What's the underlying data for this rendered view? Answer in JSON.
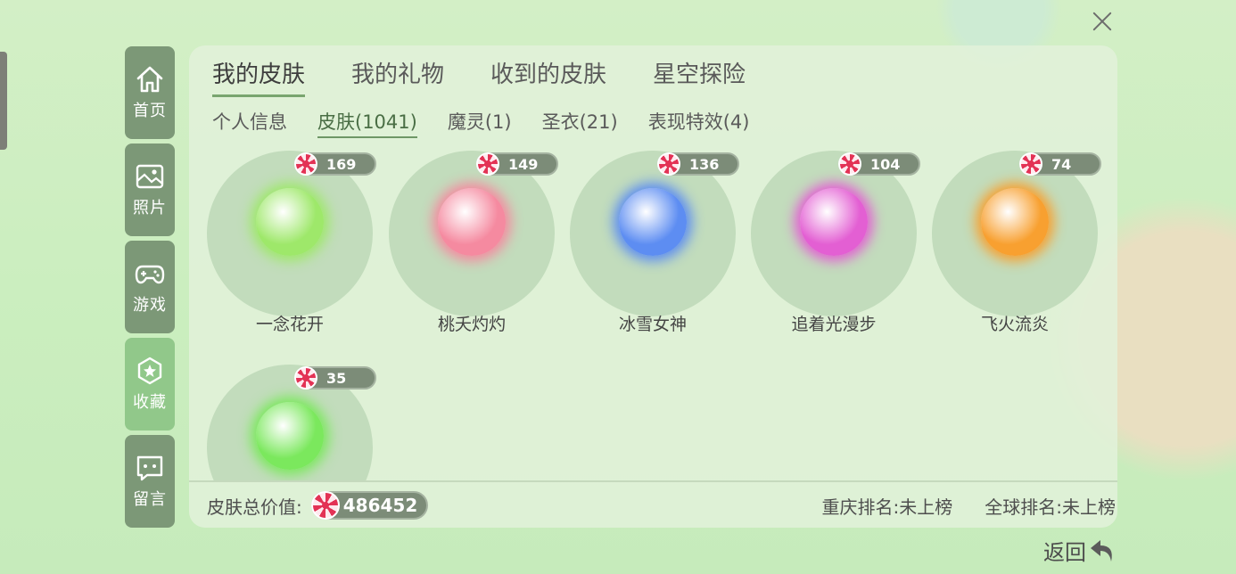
{
  "close_icon": "close-icon",
  "sidebar": {
    "items": [
      {
        "label": "首页",
        "icon": "home-icon"
      },
      {
        "label": "照片",
        "icon": "photo-icon"
      },
      {
        "label": "游戏",
        "icon": "gamepad-icon"
      },
      {
        "label": "收藏",
        "icon": "star-badge-icon",
        "active": true
      },
      {
        "label": "留言",
        "icon": "message-icon"
      }
    ]
  },
  "tabs": [
    "我的皮肤",
    "我的礼物",
    "收到的皮肤",
    "星空探险"
  ],
  "subtabs": [
    "个人信息",
    "皮肤(1041)",
    "魔灵(1)",
    "圣衣(21)",
    "表现特效(4)"
  ],
  "skins": [
    {
      "name": "一念花开",
      "price": "169",
      "color": "#9ee86a"
    },
    {
      "name": "桃夭灼灼",
      "price": "149",
      "color": "#f58aa0"
    },
    {
      "name": "冰雪女神",
      "price": "136",
      "color": "#5d8df2"
    },
    {
      "name": "追着光漫步",
      "price": "104",
      "color": "#e35fd3"
    },
    {
      "name": "飞火流炎",
      "price": "74",
      "color": "#f8a030"
    },
    {
      "name": "",
      "price": "35",
      "color": "#7be85d"
    }
  ],
  "footer": {
    "total_label": "皮肤总价值:",
    "total_value": "486452",
    "city_rank": "重庆排名:未上榜",
    "global_rank": "全球排名:未上榜"
  },
  "back_label": "返回",
  "colors": {
    "accent": "#79a56f",
    "sidebar_bg": "#7c9877",
    "sidebar_active": "#91c88a",
    "pill_bg": "#7c8c78"
  }
}
